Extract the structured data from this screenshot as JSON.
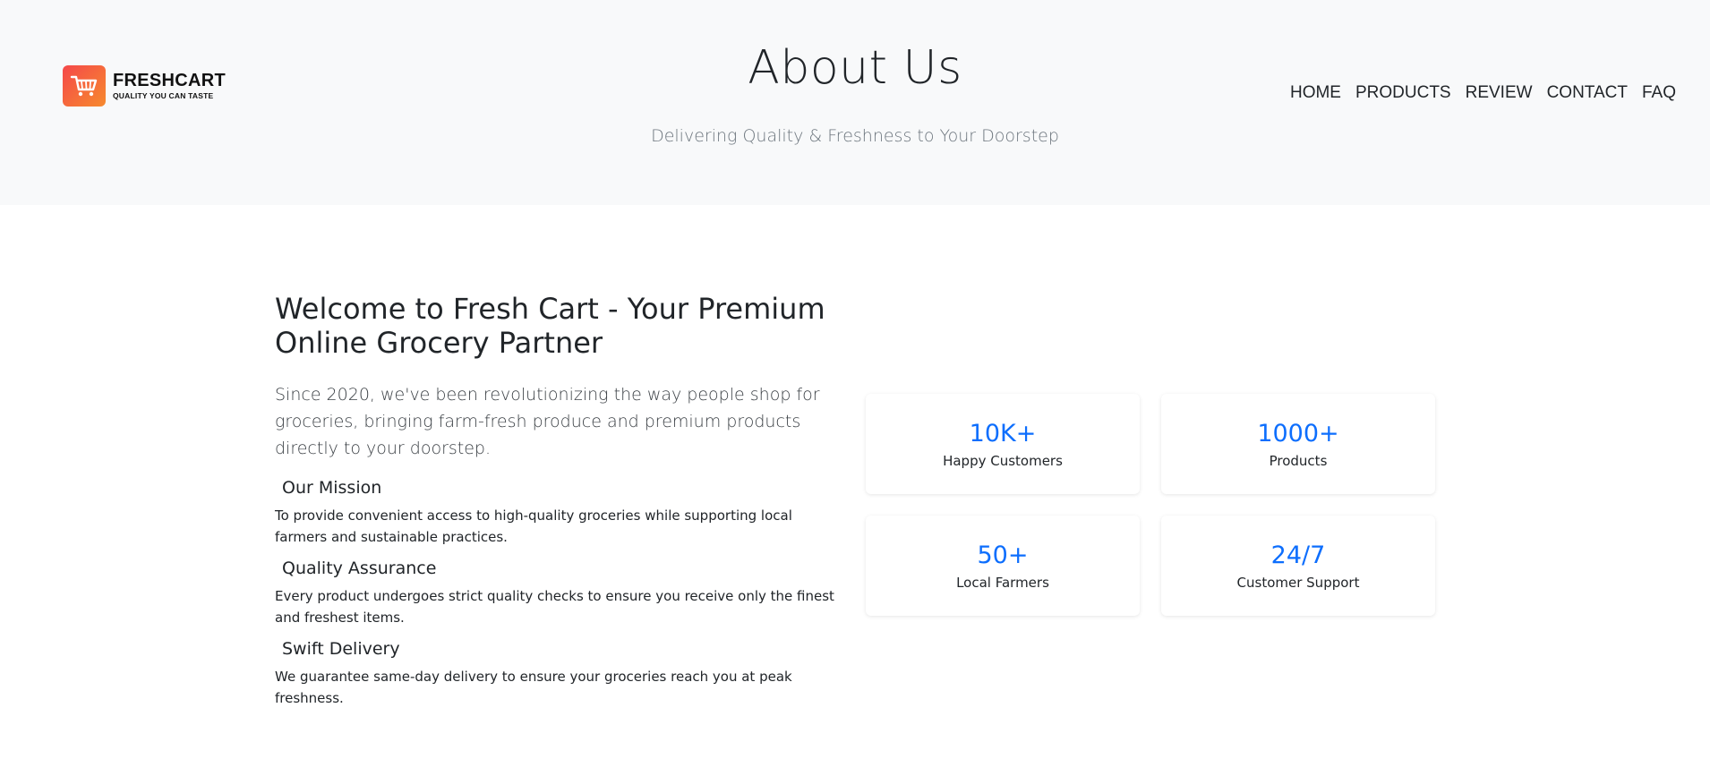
{
  "header": {
    "logo": {
      "name": "FRESHCART",
      "tagline": "QUALITY YOU CAN TASTE",
      "icon": "shopping-cart-icon"
    },
    "title": "About Us",
    "subtitle": "Delivering Quality & Freshness to Your Doorstep",
    "nav": [
      "HOME",
      "PRODUCTS",
      "REVIEW",
      "CONTACT",
      "FAQ"
    ]
  },
  "main": {
    "heading": "Welcome to Fresh Cart - Your Premium Online Grocery Partner",
    "lead": "Since 2020, we've been revolutionizing the way people shop for groceries, bringing farm-fresh produce and premium products directly to your doorstep.",
    "features": [
      {
        "title": "Our Mission",
        "text": "To provide convenient access to high-quality groceries while supporting local farmers and sustainable practices."
      },
      {
        "title": "Quality Assurance",
        "text": "Every product undergoes strict quality checks to ensure you receive only the finest and freshest items."
      },
      {
        "title": "Swift Delivery",
        "text": "We guarantee same-day delivery to ensure your groceries reach you at peak freshness."
      }
    ],
    "stats": [
      {
        "value": "10K+",
        "label": "Happy Customers"
      },
      {
        "value": "1000+",
        "label": "Products"
      },
      {
        "value": "50+",
        "label": "Local Farmers"
      },
      {
        "value": "24/7",
        "label": "Customer Support"
      }
    ]
  },
  "colors": {
    "accent": "#0d6efd",
    "hero_bg": "#f8f9fa",
    "logo_gradient_start": "#f5484a",
    "logo_gradient_end": "#f68a2e"
  }
}
